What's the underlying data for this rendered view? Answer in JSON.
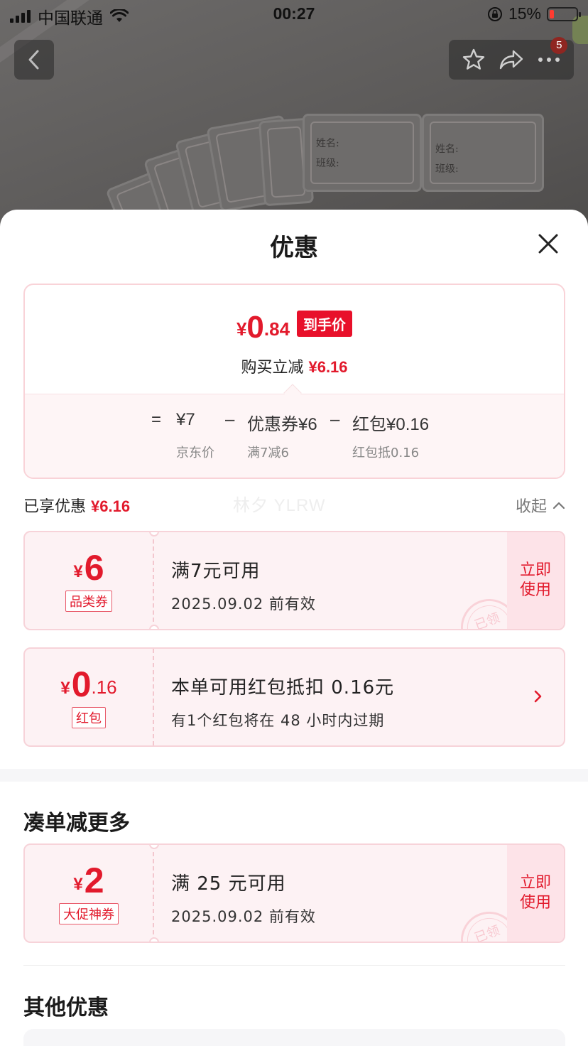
{
  "status_bar": {
    "carrier": "中国联通",
    "time": "00:27",
    "battery": "15%"
  },
  "nav": {
    "badge_count": "5"
  },
  "background_labels": {
    "name_label": "姓名:",
    "class_label": "班级:"
  },
  "sheet": {
    "title": "优惠",
    "summary": {
      "yen": "¥",
      "price_int": "0",
      "price_dec": ".84",
      "price_tag": "到手价",
      "reduce_label": "购买立减",
      "reduce_value": "¥6.16",
      "eq": "=",
      "base_price": "¥7",
      "base_label": "京东价",
      "minus1": "–",
      "coupon_term": "优惠券¥6",
      "coupon_label": "满7减6",
      "minus2": "–",
      "redpack_term": "红包¥0.16",
      "redpack_label": "红包抵0.16"
    },
    "enjoyed_label": "已享优惠",
    "enjoyed_value": "¥6.16",
    "watermark": "林夕 YLRW",
    "collapse_label": "收起",
    "coupons": [
      {
        "yen": "¥",
        "int": "6",
        "dec": "",
        "type": "品类券",
        "condition": "满7元可用",
        "validity": "2025.09.02 前有效",
        "action": "立即使用",
        "stamp": "已领"
      },
      {
        "yen": "¥",
        "int": "0",
        "dec": ".16",
        "type": "红包",
        "condition": "本单可用红包抵扣 0.16元",
        "validity": "有1个红包将在 48 小时内过期"
      }
    ],
    "more_section_title": "凑单减更多",
    "more_coupons": [
      {
        "yen": "¥",
        "int": "2",
        "type": "大促神券",
        "condition": "满 25 元可用",
        "validity": "2025.09.02 前有效",
        "action": "立即使用",
        "stamp": "已领"
      }
    ],
    "other_section_title": "其他优惠"
  },
  "colors": {
    "accent_red": "#e21a2c",
    "coupon_bg": "#fdf2f4",
    "coupon_border": "#f7d3d9"
  }
}
